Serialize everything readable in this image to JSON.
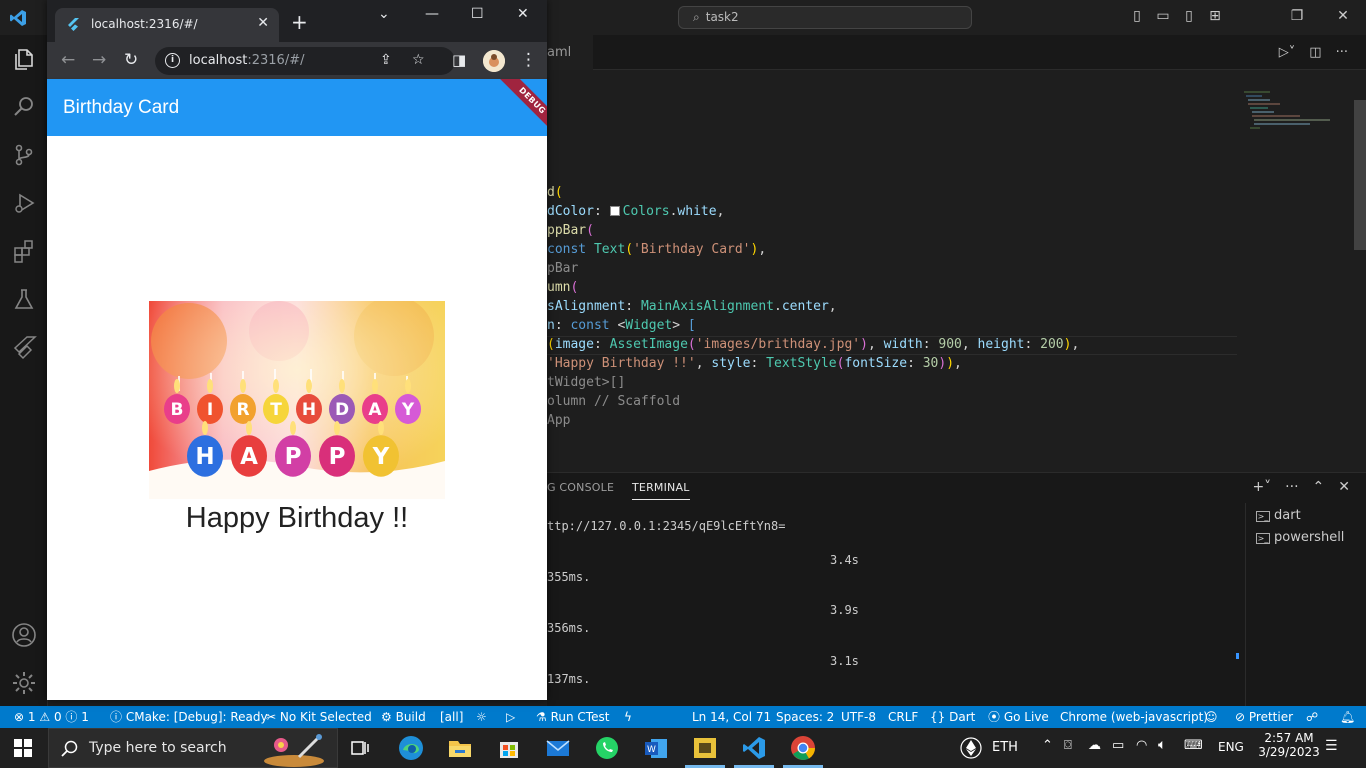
{
  "vscode": {
    "search_text": "task2",
    "tab_fragment": "aml",
    "code_lines": [
      [
        {
          "c": "t-fn",
          "t": "d"
        },
        {
          "c": "t-br",
          "t": "("
        }
      ],
      [
        {
          "c": "t-prop",
          "t": "dColor"
        },
        {
          "c": "",
          "t": ": "
        },
        {
          "c": "swatch",
          "t": ""
        },
        {
          "c": "t-type",
          "t": "Colors"
        },
        {
          "c": "",
          "t": "."
        },
        {
          "c": "t-prop",
          "t": "white"
        },
        {
          "c": "",
          "t": ","
        }
      ],
      [
        {
          "c": "t-fn",
          "t": "ppBar"
        },
        {
          "c": "t-br2",
          "t": "("
        }
      ],
      [
        {
          "c": "t-kw",
          "t": "const "
        },
        {
          "c": "t-type",
          "t": "Text"
        },
        {
          "c": "t-br",
          "t": "("
        },
        {
          "c": "t-str",
          "t": "'Birthday Card'"
        },
        {
          "c": "t-br",
          "t": ")"
        },
        {
          "c": "",
          "t": ","
        }
      ],
      [
        {
          "c": "t-cm",
          "t": "pBar"
        }
      ],
      [
        {
          "c": "t-fn",
          "t": "umn"
        },
        {
          "c": "t-br2",
          "t": "("
        }
      ],
      [
        {
          "c": "t-prop",
          "t": "sAlignment"
        },
        {
          "c": "",
          "t": ": "
        },
        {
          "c": "t-type",
          "t": "MainAxisAlignment"
        },
        {
          "c": "",
          "t": "."
        },
        {
          "c": "t-prop",
          "t": "center"
        },
        {
          "c": "",
          "t": ","
        }
      ],
      [
        {
          "c": "t-prop",
          "t": "n"
        },
        {
          "c": "",
          "t": ": "
        },
        {
          "c": "t-kw",
          "t": "const "
        },
        {
          "c": "",
          "t": "<"
        },
        {
          "c": "t-type",
          "t": "Widget"
        },
        {
          "c": "",
          "t": "> "
        },
        {
          "c": "t-kw",
          "t": "["
        }
      ],
      [
        {
          "c": "t-br",
          "t": "("
        },
        {
          "c": "t-prop",
          "t": "image"
        },
        {
          "c": "",
          "t": ": "
        },
        {
          "c": "t-type",
          "t": "AssetImage"
        },
        {
          "c": "t-br2",
          "t": "("
        },
        {
          "c": "t-str",
          "t": "'images/brithday.jpg'"
        },
        {
          "c": "t-br2",
          "t": ")"
        },
        {
          "c": "",
          "t": ", "
        },
        {
          "c": "t-prop",
          "t": "width"
        },
        {
          "c": "",
          "t": ": "
        },
        {
          "c": "t-num",
          "t": "900"
        },
        {
          "c": "",
          "t": ", "
        },
        {
          "c": "t-prop",
          "t": "height"
        },
        {
          "c": "",
          "t": ": "
        },
        {
          "c": "t-num",
          "t": "200"
        },
        {
          "c": "t-br",
          "t": ")"
        },
        {
          "c": "",
          "t": ","
        }
      ],
      [
        {
          "c": "t-str",
          "t": "'Happy Birthday !!'"
        },
        {
          "c": "",
          "t": ", "
        },
        {
          "c": "t-prop",
          "t": "style"
        },
        {
          "c": "",
          "t": ": "
        },
        {
          "c": "t-type",
          "t": "TextStyle"
        },
        {
          "c": "t-br2",
          "t": "("
        },
        {
          "c": "t-prop",
          "t": "fontSize"
        },
        {
          "c": "",
          "t": ": "
        },
        {
          "c": "t-num",
          "t": "30"
        },
        {
          "c": "t-br2",
          "t": ")"
        },
        {
          "c": "t-br",
          "t": ")"
        },
        {
          "c": "",
          "t": ","
        }
      ],
      [
        {
          "c": "t-cm",
          "t": "tWidget>[]"
        }
      ],
      [
        {
          "c": "t-cm",
          "t": "olumn // Scaffold"
        }
      ],
      [
        {
          "c": "t-cm",
          "t": "App"
        }
      ]
    ],
    "panel": {
      "tab_console": "G CONSOLE",
      "tab_terminal": "TERMINAL",
      "terminal_lines": [
        "ttp://127.0.0.1:2345/qE9lcEftYn8=",
        "3.4s",
        "355ms.",
        "3.9s",
        "356ms.",
        "3.1s",
        "137ms."
      ],
      "terminals": [
        "dart",
        "powershell"
      ]
    },
    "statusbar": {
      "errors": "1",
      "warnings": "0",
      "info": "1",
      "cmake": "CMake: [Debug]: Ready",
      "kit": "No Kit Selected",
      "build": "Build",
      "all": "[all]",
      "ctest": "Run CTest",
      "position": "Ln 14, Col 71",
      "spaces": "Spaces: 2",
      "encoding": "UTF-8",
      "eol": "CRLF",
      "language": "Dart",
      "golive": "Go Live",
      "device": "Chrome (web-javascript)",
      "prettier": "Prettier"
    }
  },
  "chrome": {
    "tab_title": "localhost:2316/#/",
    "url_host": "localhost",
    "url_path": ":2316/#/",
    "app": {
      "title": "Birthday Card",
      "debug_label": "DEBUG",
      "message": "Happy Birthday !!",
      "candle_letters_top": [
        "B",
        "I",
        "R",
        "T",
        "H",
        "D",
        "A",
        "Y"
      ],
      "candle_letters_bottom": [
        "H",
        "A",
        "P",
        "P",
        "Y"
      ]
    }
  },
  "taskbar": {
    "search_placeholder": "Type here to search",
    "crypto": "ETH",
    "language": "ENG",
    "time": "2:57 AM",
    "date": "3/29/2023"
  },
  "colors": {
    "flutter_blue": "#2196f3",
    "statusbar_blue": "#007acc",
    "debug_banner": "#a0243f"
  }
}
